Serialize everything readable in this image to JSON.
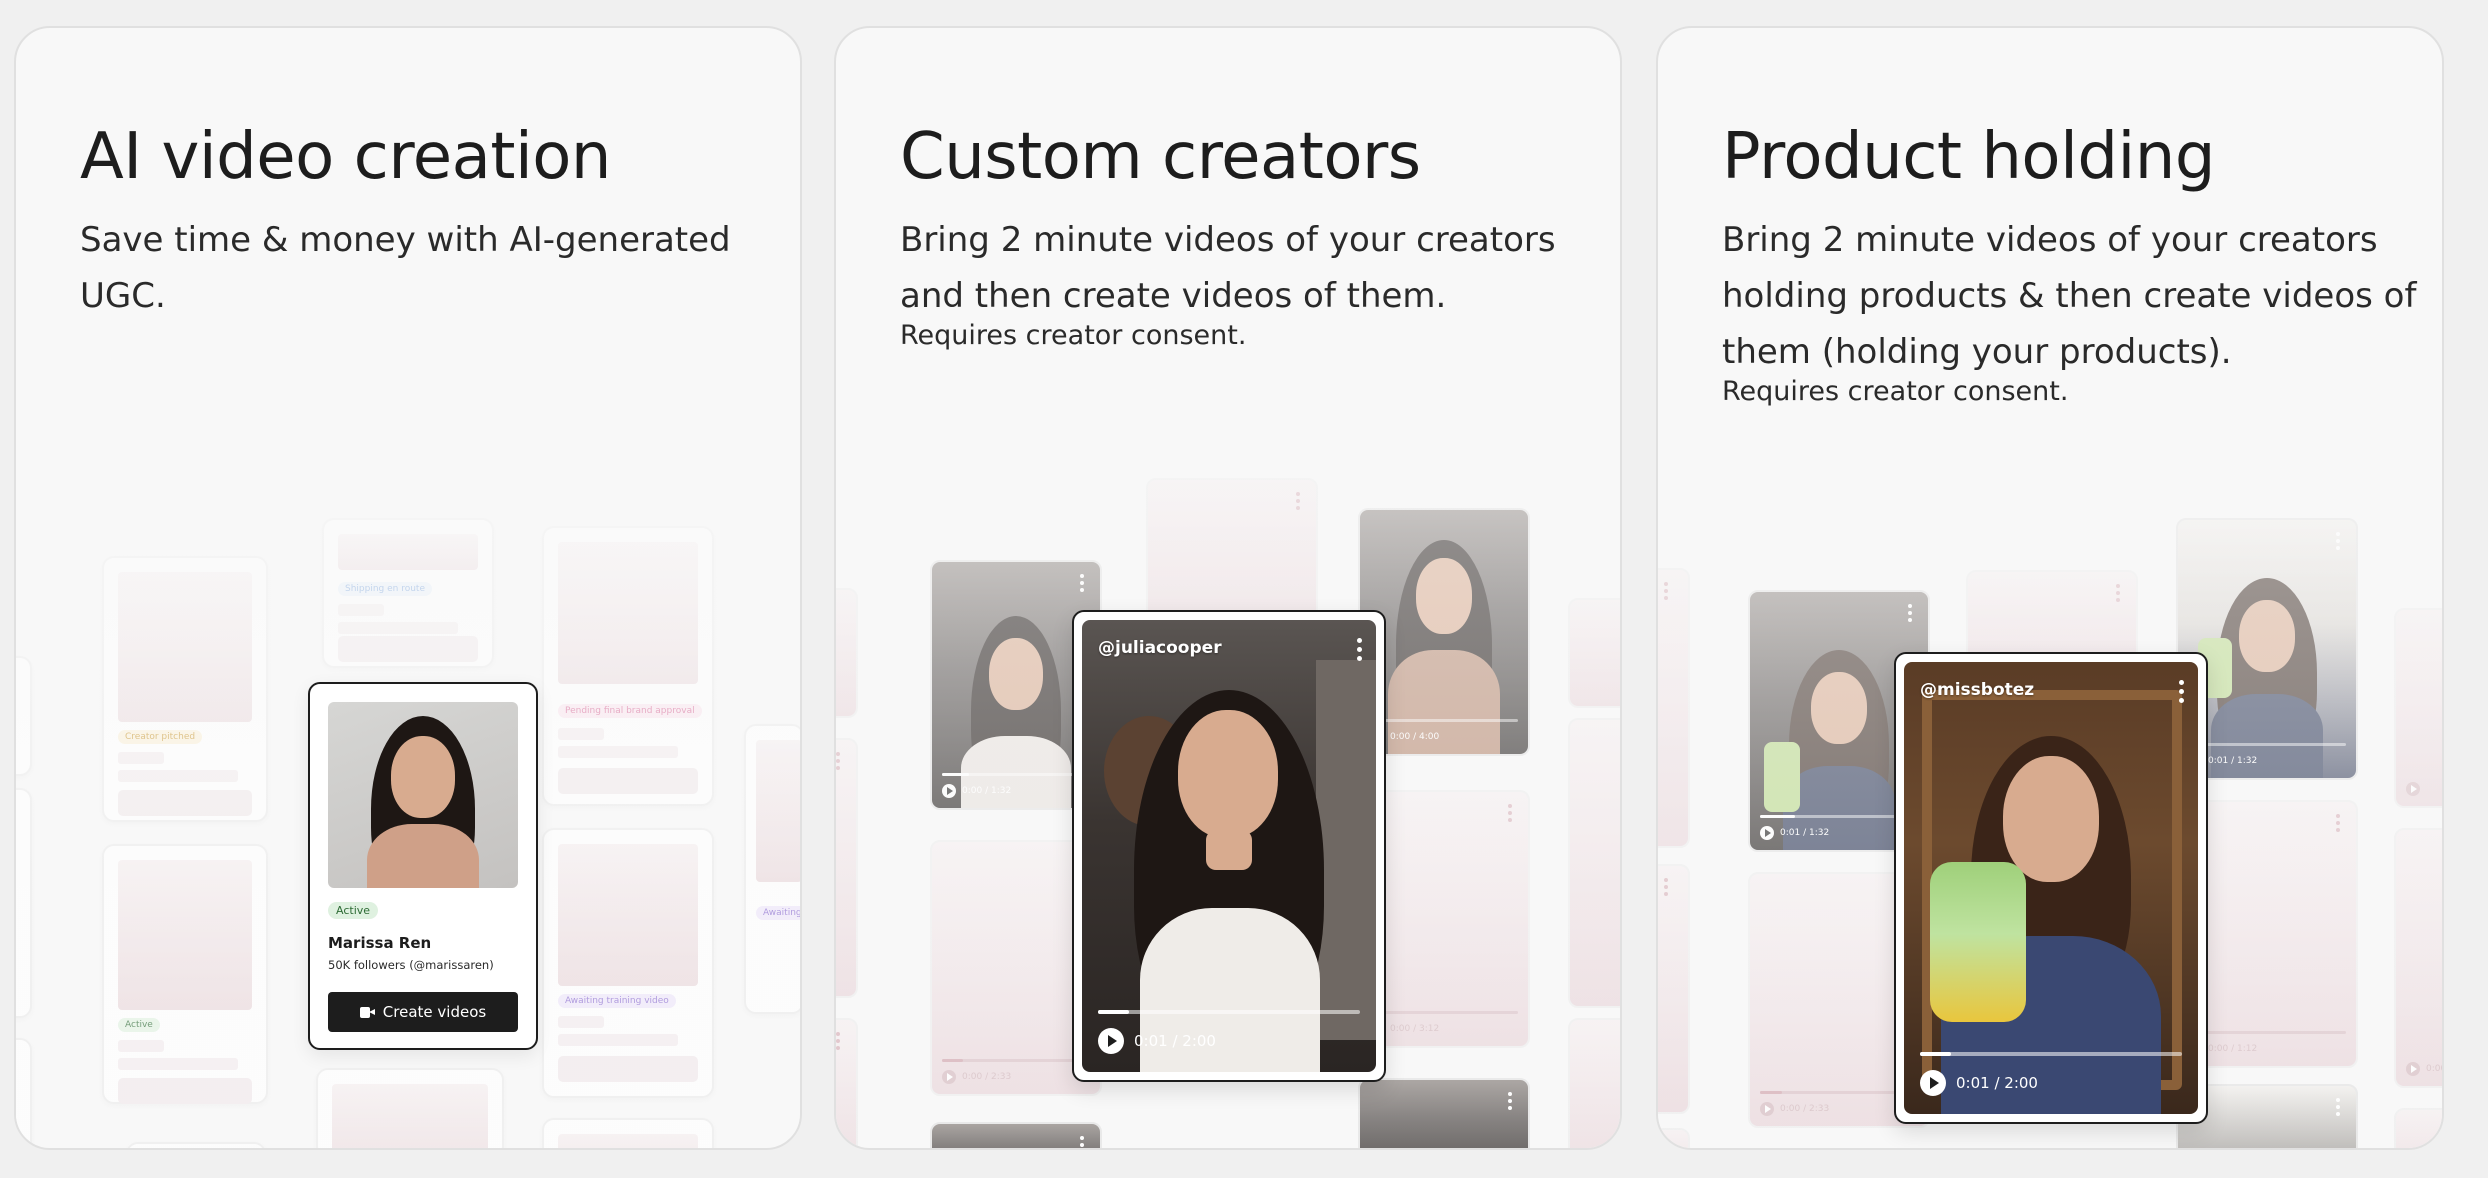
{
  "cards": [
    {
      "title": "AI video creation",
      "description": "Save time & money with AI-generated UGC.",
      "note": ""
    },
    {
      "title": "Custom creators",
      "description": "Bring 2 minute videos of your creators and then create videos of them.",
      "note": "Requires creator consent."
    },
    {
      "title": "Product holding",
      "description": "Bring 2 minute videos of your creators holding products & then create videos of them (holding your products).",
      "note": "Requires creator consent."
    }
  ],
  "profile": {
    "status": "Active",
    "name": "Marissa Ren",
    "followers": "50K followers (@marissaren)",
    "button_label": "Create videos"
  },
  "bg_pills": {
    "shipping": "Shipping en route",
    "pending": "Pending final brand approval",
    "pitched": "Creator pitched",
    "active": "Active",
    "awaiting": "Awaiting training video",
    "awaiting_short": "Awaiting"
  },
  "players": {
    "custom": {
      "handle": "@juliacooper",
      "time": "0:01  /  2:00"
    },
    "product": {
      "handle": "@missbotez",
      "time": "0:01  /  2:00"
    }
  },
  "tile_times": {
    "t1": "0:00 / 1:32",
    "t2": "0:00 / 2:33",
    "t3": "0:00 / 4:00",
    "t4": "0:00 / 3:12",
    "t5": "0:01 / 1:32",
    "t6": "0:00 / 2:33",
    "t7": "0:01 / 1:32",
    "t8": "0:00 / 1:12",
    "t9": "0:00"
  },
  "brand_colors": {
    "ink": "#1d1d1d",
    "card_bg": "#f8f8f8",
    "active_green": "#2d6b34",
    "pending_pink": "#d4548a",
    "shipping_blue": "#5b8fd6",
    "pitched_amber": "#c48d1b",
    "awaiting_purple": "#8a6bd0"
  }
}
